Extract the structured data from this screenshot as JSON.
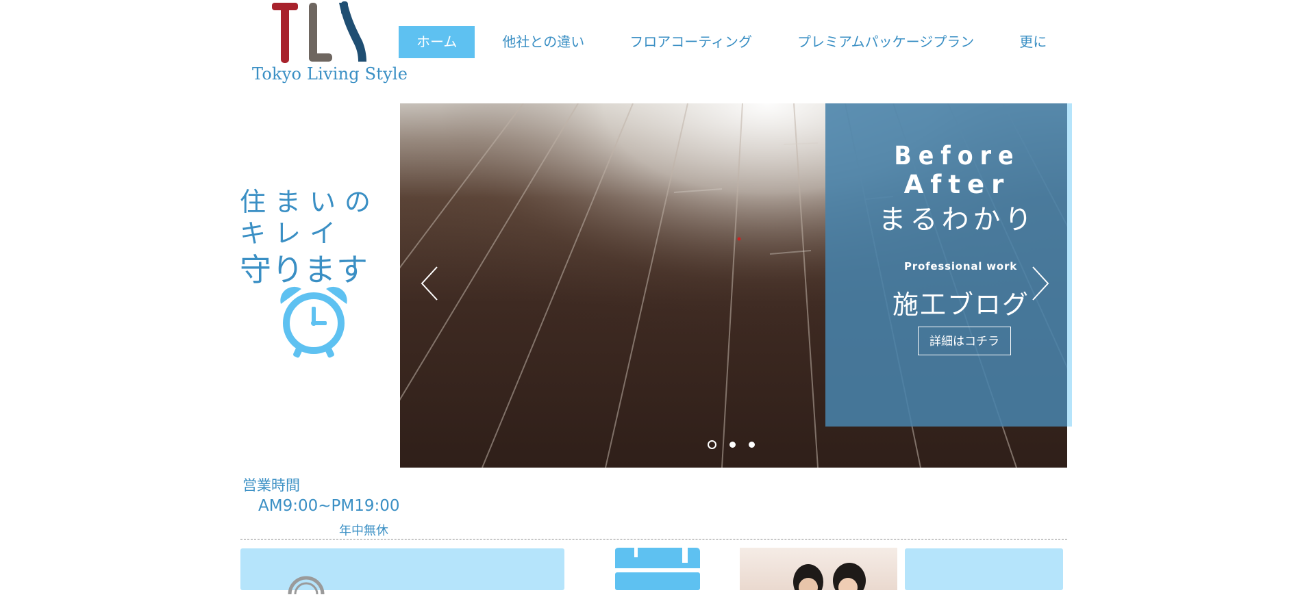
{
  "logo": {
    "text": "Tokyo Living Style",
    "letters": "TLS",
    "colors": [
      "#a8222c",
      "#6e6660",
      "#1f4e72"
    ]
  },
  "nav": {
    "items": [
      {
        "label": "ホーム",
        "active": true
      },
      {
        "label": "他社との違い",
        "active": false
      },
      {
        "label": "フロアコーティング",
        "active": false
      },
      {
        "label": "プレミアムパッケージプラン",
        "active": false
      },
      {
        "label": "更に",
        "active": false
      }
    ]
  },
  "slogan": {
    "line1": "住まいの",
    "line2": "キレイ",
    "line3": "守ります",
    "icon": "alarm-clock-icon"
  },
  "slider": {
    "panel": {
      "line1": "Before",
      "line2": "After",
      "line3": "まるわかり",
      "subtitle": "Professional work",
      "title": "施工ブログ",
      "button": "詳細はコチラ"
    },
    "prev_icon": "chevron-left-icon",
    "next_icon": "chevron-right-icon",
    "dots": 3,
    "active_dot": 0
  },
  "hours": {
    "title": "営業時間",
    "time": "AM9:00~PM19:00",
    "note": "年中無休"
  },
  "colors": {
    "accent": "#5ec1f1",
    "text": "#3a8fc4",
    "light": "#b5e4fb",
    "panel": "#4882aa"
  }
}
